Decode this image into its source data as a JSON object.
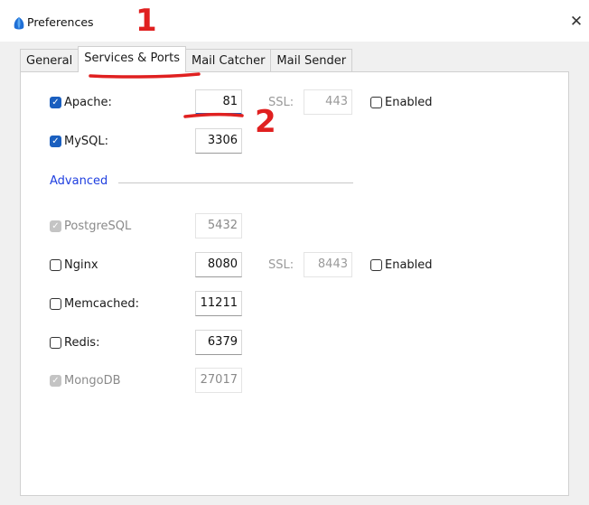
{
  "window": {
    "title": "Preferences",
    "close_label": "✕"
  },
  "tabs": [
    {
      "label": "General",
      "active": false
    },
    {
      "label": "Services & Ports",
      "active": true
    },
    {
      "label": "Mail Catcher",
      "active": false
    },
    {
      "label": "Mail Sender",
      "active": false
    }
  ],
  "services": {
    "apache": {
      "label": "Apache:",
      "port": "81",
      "checked": true,
      "ssl_label": "SSL:",
      "ssl_port": "443",
      "ssl_enabled_label": "Enabled"
    },
    "mysql": {
      "label": "MySQL:",
      "port": "3306",
      "checked": true
    },
    "advanced_label": "Advanced",
    "postgresql": {
      "label": "PostgreSQL",
      "port": "5432",
      "checked": true,
      "disabled": true
    },
    "nginx": {
      "label": "Nginx",
      "port": "8080",
      "checked": false,
      "ssl_label": "SSL:",
      "ssl_port": "8443",
      "ssl_enabled_label": "Enabled"
    },
    "memcached": {
      "label": "Memcached:",
      "port": "11211",
      "checked": false
    },
    "redis": {
      "label": "Redis:",
      "port": "6379",
      "checked": false
    },
    "mongodb": {
      "label": "MongoDB",
      "port": "27017",
      "checked": true,
      "disabled": true
    }
  },
  "annotations": {
    "one": "1",
    "two": "2"
  },
  "colors": {
    "accent": "#1a5fbf",
    "advanced": "#1f3fe0",
    "annotation": "#e02020"
  }
}
